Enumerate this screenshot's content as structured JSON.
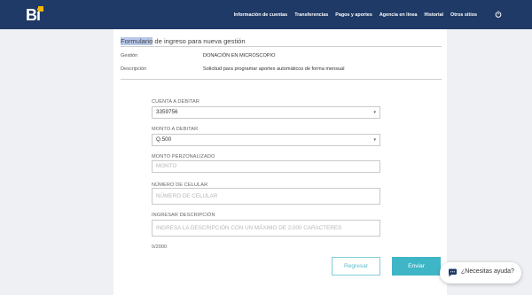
{
  "brand": {
    "logo_text": "Bi",
    "accent": "#f6b700",
    "nav_bg": "#1f3a66"
  },
  "nav": {
    "items": [
      "Información de cuentas",
      "Transferencias",
      "Pagos y aportes",
      "Agencia en línea",
      "Historial",
      "Otros sitios"
    ],
    "power_icon": "power-icon"
  },
  "form": {
    "title_highlight": "Formulario",
    "title_rest": " de ingreso para nueva gestión",
    "info": [
      {
        "label": "Gestión",
        "value": "DONACIÓN EN MICROSCOPIO"
      },
      {
        "label": "Descripción",
        "value": "Solicitud para programar aportes automáticos de forma mensual"
      }
    ],
    "account": {
      "label": "CUENTA A DEBITAR",
      "value": "3359756"
    },
    "amount": {
      "label": "MONTO A DEBITAR",
      "value": "Q.500"
    },
    "custom_amount": {
      "label": "MONTO PERZONALIZADO",
      "placeholder": "MONTO"
    },
    "phone": {
      "label": "NÚMERO DE CELULAR",
      "placeholder": "NÚMERO DE CELULAR"
    },
    "description": {
      "label": "INGRESAR DESCRIPCIÓN",
      "placeholder": "INGRESA LA DESCRIPCIÓN CON UN MÁXIMO DE 2,000 CARACTERES"
    },
    "counter": "0/2000",
    "reset_label": "Regresar",
    "submit_label": "Enviar",
    "button_color": "#3fb6c6"
  },
  "chat": {
    "label": "¿Necesitas ayuda?"
  }
}
